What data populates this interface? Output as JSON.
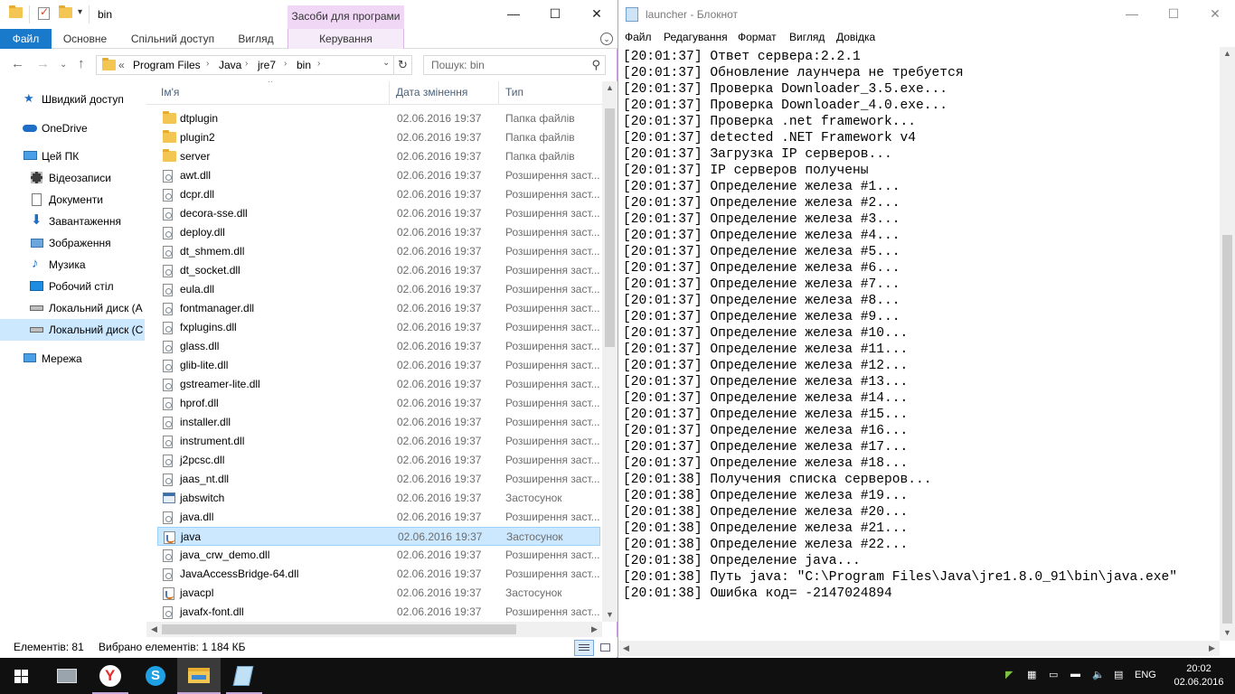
{
  "explorer": {
    "title": "bin",
    "ribbon_context_group": "Засоби для програми",
    "tabs": [
      "Файл",
      "Основне",
      "Спільний доступ",
      "Вигляд",
      "Керування"
    ],
    "address": {
      "overflow": "«",
      "crumbs": [
        "Program Files",
        "Java",
        "jre7",
        "bin"
      ]
    },
    "search_placeholder": "Пошук: bin",
    "nav": [
      {
        "label": "Швидкий доступ",
        "icon": "star-icon"
      },
      {
        "label": "OneDrive",
        "icon": "cloud-icon"
      },
      {
        "label": "Цей ПК",
        "icon": "computer-icon"
      },
      {
        "label": "Відеозаписи",
        "icon": "video-icon"
      },
      {
        "label": "Документи",
        "icon": "document-icon"
      },
      {
        "label": "Завантаження",
        "icon": "download-icon"
      },
      {
        "label": "Зображення",
        "icon": "pictures-icon"
      },
      {
        "label": "Музика",
        "icon": "music-icon"
      },
      {
        "label": "Робочий стіл",
        "icon": "desktop-icon"
      },
      {
        "label": "Локальний диск (A",
        "icon": "drive-icon"
      },
      {
        "label": "Локальний диск (C",
        "icon": "drive-icon"
      },
      {
        "label": "Мережа",
        "icon": "network-icon"
      }
    ],
    "columns": [
      "Ім'я",
      "Дата змінення",
      "Тип"
    ],
    "files": [
      {
        "name": "dtplugin",
        "date": "02.06.2016 19:37",
        "type": "Папка файлів",
        "icon": "folder-icon"
      },
      {
        "name": "plugin2",
        "date": "02.06.2016 19:37",
        "type": "Папка файлів",
        "icon": "folder-icon"
      },
      {
        "name": "server",
        "date": "02.06.2016 19:37",
        "type": "Папка файлів",
        "icon": "folder-icon"
      },
      {
        "name": "awt.dll",
        "date": "02.06.2016 19:37",
        "type": "Розширення заст...",
        "icon": "dll-icon"
      },
      {
        "name": "dcpr.dll",
        "date": "02.06.2016 19:37",
        "type": "Розширення заст...",
        "icon": "dll-icon"
      },
      {
        "name": "decora-sse.dll",
        "date": "02.06.2016 19:37",
        "type": "Розширення заст...",
        "icon": "dll-icon"
      },
      {
        "name": "deploy.dll",
        "date": "02.06.2016 19:37",
        "type": "Розширення заст...",
        "icon": "dll-icon"
      },
      {
        "name": "dt_shmem.dll",
        "date": "02.06.2016 19:37",
        "type": "Розширення заст...",
        "icon": "dll-icon"
      },
      {
        "name": "dt_socket.dll",
        "date": "02.06.2016 19:37",
        "type": "Розширення заст...",
        "icon": "dll-icon"
      },
      {
        "name": "eula.dll",
        "date": "02.06.2016 19:37",
        "type": "Розширення заст...",
        "icon": "dll-icon"
      },
      {
        "name": "fontmanager.dll",
        "date": "02.06.2016 19:37",
        "type": "Розширення заст...",
        "icon": "dll-icon"
      },
      {
        "name": "fxplugins.dll",
        "date": "02.06.2016 19:37",
        "type": "Розширення заст...",
        "icon": "dll-icon"
      },
      {
        "name": "glass.dll",
        "date": "02.06.2016 19:37",
        "type": "Розширення заст...",
        "icon": "dll-icon"
      },
      {
        "name": "glib-lite.dll",
        "date": "02.06.2016 19:37",
        "type": "Розширення заст...",
        "icon": "dll-icon"
      },
      {
        "name": "gstreamer-lite.dll",
        "date": "02.06.2016 19:37",
        "type": "Розширення заст...",
        "icon": "dll-icon"
      },
      {
        "name": "hprof.dll",
        "date": "02.06.2016 19:37",
        "type": "Розширення заст...",
        "icon": "dll-icon"
      },
      {
        "name": "installer.dll",
        "date": "02.06.2016 19:37",
        "type": "Розширення заст...",
        "icon": "dll-icon"
      },
      {
        "name": "instrument.dll",
        "date": "02.06.2016 19:37",
        "type": "Розширення заст...",
        "icon": "dll-icon"
      },
      {
        "name": "j2pcsc.dll",
        "date": "02.06.2016 19:37",
        "type": "Розширення заст...",
        "icon": "dll-icon"
      },
      {
        "name": "jaas_nt.dll",
        "date": "02.06.2016 19:37",
        "type": "Розширення заст...",
        "icon": "dll-icon"
      },
      {
        "name": "jabswitch",
        "date": "02.06.2016 19:37",
        "type": "Застосунок",
        "icon": "exe-icon"
      },
      {
        "name": "java.dll",
        "date": "02.06.2016 19:37",
        "type": "Розширення заст...",
        "icon": "dll-icon"
      },
      {
        "name": "java",
        "date": "02.06.2016 19:37",
        "type": "Застосунок",
        "icon": "java-icon",
        "selected": true
      },
      {
        "name": "java_crw_demo.dll",
        "date": "02.06.2016 19:37",
        "type": "Розширення заст...",
        "icon": "dll-icon"
      },
      {
        "name": "JavaAccessBridge-64.dll",
        "date": "02.06.2016 19:37",
        "type": "Розширення заст...",
        "icon": "dll-icon"
      },
      {
        "name": "javacpl",
        "date": "02.06.2016 19:37",
        "type": "Застосунок",
        "icon": "java-icon"
      },
      {
        "name": "javafx-font.dll",
        "date": "02.06.2016 19:37",
        "type": "Розширення заст...",
        "icon": "dll-icon"
      }
    ],
    "status": {
      "items": "Елементів: 81",
      "selected": "Вибрано елементів: 1  184 КБ"
    },
    "accent_color": "#1979ca",
    "selection_color": "#cce8ff"
  },
  "notepad": {
    "title": "launcher - Блокнот",
    "menu": [
      "Файл",
      "Редагування",
      "Формат",
      "Вигляд",
      "Довідка"
    ],
    "lines": [
      "[20:01:37] Ответ сервера:2.2.1",
      "[20:01:37] Обновление лаунчера не требуется",
      "[20:01:37] Проверка Downloader_3.5.exe...",
      "[20:01:37] Проверка Downloader_4.0.exe...",
      "[20:01:37] Проверка .net framework...",
      "[20:01:37] detected .NET Framework v4",
      "[20:01:37] Загрузка IP серверов...",
      "[20:01:37] IP серверов получены",
      "[20:01:37] Определение железа #1...",
      "[20:01:37] Определение железа #2...",
      "[20:01:37] Определение железа #3...",
      "[20:01:37] Определение железа #4...",
      "[20:01:37] Определение железа #5...",
      "[20:01:37] Определение железа #6...",
      "[20:01:37] Определение железа #7...",
      "[20:01:37] Определение железа #8...",
      "[20:01:37] Определение железа #9...",
      "[20:01:37] Определение железа #10...",
      "[20:01:37] Определение железа #11...",
      "[20:01:37] Определение железа #12...",
      "[20:01:37] Определение железа #13...",
      "[20:01:37] Определение железа #14...",
      "[20:01:37] Определение железа #15...",
      "[20:01:37] Определение железа #16...",
      "[20:01:37] Определение железа #17...",
      "[20:01:37] Определение железа #18...",
      "[20:01:38] Получения списка серверов...",
      "[20:01:38] Определение железа #19...",
      "[20:01:38] Определение железа #20...",
      "[20:01:38] Определение железа #21...",
      "[20:01:38] Определение железа #22...",
      "[20:01:38] Определение java...",
      "[20:01:38] Путь java: \"C:\\Program Files\\Java\\jre1.8.0_91\\bin\\java.exe\"",
      "[20:01:38] Ошибка код= -2147024894"
    ]
  },
  "taskbar": {
    "apps": [
      {
        "name": "task-view-app-icon"
      },
      {
        "name": "yandex-browser-icon"
      },
      {
        "name": "skype-icon"
      },
      {
        "name": "file-explorer-icon"
      },
      {
        "name": "notepad-app-icon"
      }
    ],
    "language": "ENG",
    "time": "20:02",
    "date": "02.06.2016"
  }
}
